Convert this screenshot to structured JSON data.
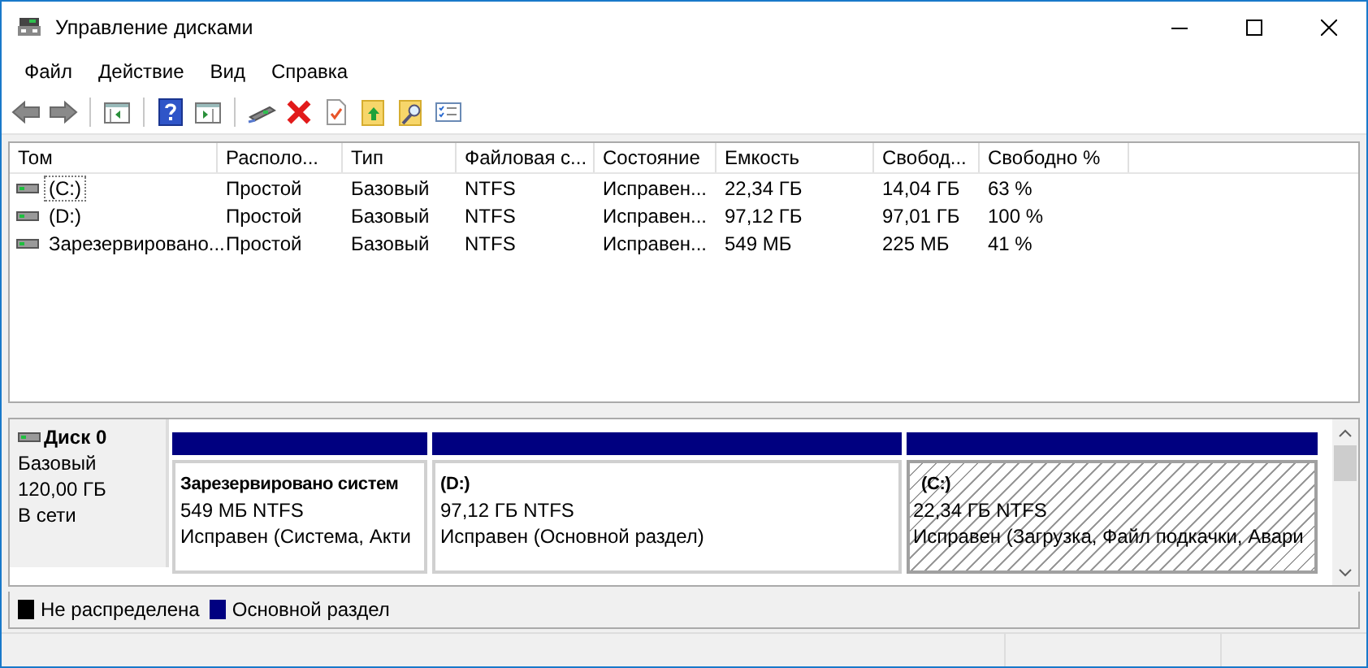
{
  "window": {
    "title": "Управление дисками"
  },
  "menu": [
    "Файл",
    "Действие",
    "Вид",
    "Справка"
  ],
  "table": {
    "columns": [
      "Том",
      "Располо...",
      "Тип",
      "Файловая с...",
      "Состояние",
      "Емкость",
      "Свобод...",
      "Свободно %"
    ],
    "rows": [
      {
        "focused": true,
        "cells": [
          "(C:)",
          "Простой",
          "Базовый",
          "NTFS",
          "Исправен...",
          "22,34 ГБ",
          "14,04 ГБ",
          "63 %"
        ]
      },
      {
        "focused": false,
        "cells": [
          "(D:)",
          "Простой",
          "Базовый",
          "NTFS",
          "Исправен...",
          "97,12 ГБ",
          "97,01 ГБ",
          "100 %"
        ]
      },
      {
        "focused": false,
        "cells": [
          "Зарезервировано...",
          "Простой",
          "Базовый",
          "NTFS",
          "Исправен...",
          "549 МБ",
          "225 МБ",
          "41 %"
        ]
      }
    ]
  },
  "disks": [
    {
      "name": "Диск 0",
      "type": "Базовый",
      "size": "120,00 ГБ",
      "status": "В сети",
      "partitions": [
        {
          "name": "Зарезервировано систем",
          "size": "549 МБ NTFS",
          "status": "Исправен (Система, Акти",
          "selected": false
        },
        {
          "name": "(D:)",
          "size": "97,12 ГБ NTFS",
          "status": "Исправен (Основной раздел)",
          "selected": false
        },
        {
          "name": "(C:)",
          "size": "22,34 ГБ NTFS",
          "status": "Исправен (Загрузка, Файл подкачки, Авари",
          "selected": true
        }
      ]
    }
  ],
  "legend": [
    {
      "label": "Не распределена",
      "color": "#000000"
    },
    {
      "label": "Основной раздел",
      "color": "#000080"
    }
  ]
}
